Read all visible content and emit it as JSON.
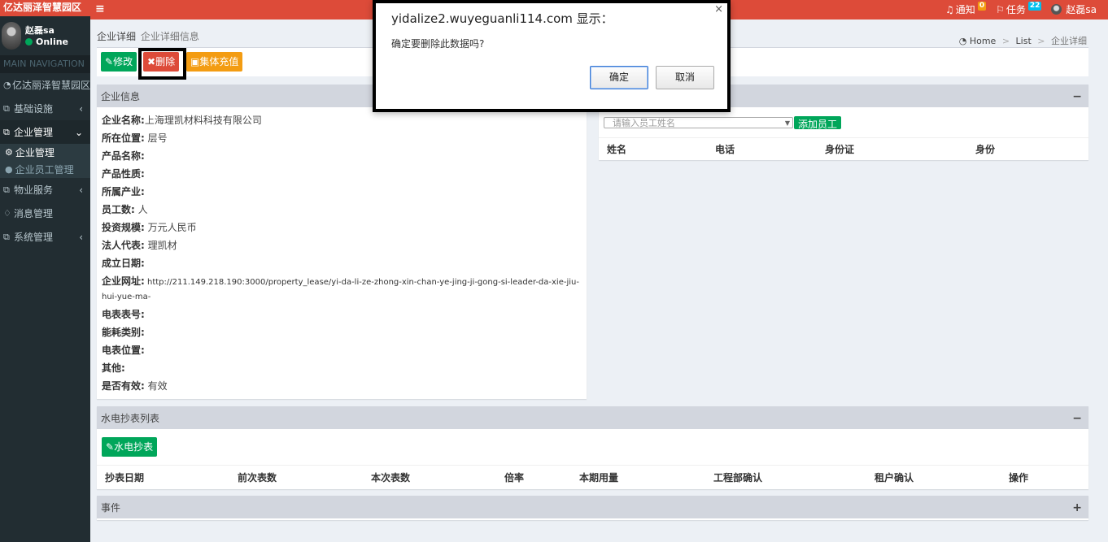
{
  "sidebar": {
    "logo": "亿达丽泽智慧园区",
    "user_name": "赵磊sa",
    "status": "Online",
    "nav_header": "MAIN NAVIGATION",
    "items": [
      {
        "label": "亿达丽泽智慧园区",
        "icon": "dashboard-icon"
      },
      {
        "label": "基础设施",
        "icon": "copy-icon"
      },
      {
        "label": "企业管理",
        "icon": "copy-icon"
      },
      {
        "label": "物业服务",
        "icon": "copy-icon"
      },
      {
        "label": "消息管理",
        "icon": "bell-icon"
      },
      {
        "label": "系统管理",
        "icon": "copy-icon"
      }
    ],
    "sub_items": [
      {
        "label": "企业管理",
        "icon": "gear-icon"
      },
      {
        "label": "企业员工管理",
        "icon": "user-icon"
      }
    ]
  },
  "topbar": {
    "notices_label": "通知",
    "notices_count": "0",
    "tasks_label": "任务",
    "tasks_count": "22",
    "user_name": "赵磊sa"
  },
  "page": {
    "title": "企业详细",
    "subtitle": "企业详细信息",
    "breadcrumb": [
      "Home",
      "List",
      "企业详细"
    ]
  },
  "actions": {
    "edit": "修改",
    "delete": "删除",
    "recharge": "集体充值"
  },
  "company": {
    "header": "企业信息",
    "collapse": "−",
    "rows": [
      {
        "label": "企业名称:",
        "value": "上海理凯材料科技有限公司"
      },
      {
        "label": "所在位置:",
        "value": " 层号"
      },
      {
        "label": "产品名称:",
        "value": ""
      },
      {
        "label": "产品性质:",
        "value": ""
      },
      {
        "label": "所属产业:",
        "value": ""
      },
      {
        "label": "员工数:",
        "value": " 人"
      },
      {
        "label": "投资规模:",
        "value": " 万元人民币"
      },
      {
        "label": "法人代表:",
        "value": " 理凯材"
      },
      {
        "label": "成立日期:",
        "value": ""
      },
      {
        "label": "企业网址:",
        "value": " http://211.149.218.190:3000/property_lease/yi-da-li-ze-zhong-xin-chan-ye-jing-ji-gong-si-leader-da-xie-jiu-hui-yue-ma-"
      },
      {
        "label": "电表表号:",
        "value": ""
      },
      {
        "label": "能耗类别:",
        "value": ""
      },
      {
        "label": "电表位置:",
        "value": ""
      },
      {
        "label": "其他:",
        "value": ""
      },
      {
        "label": "是否有效:",
        "value": " 有效"
      }
    ]
  },
  "staff": {
    "collapse": "−",
    "select_placeholder": "请输入员工姓名",
    "add_button": "添加员工",
    "columns": [
      "姓名",
      "电话",
      "身份证",
      "身份"
    ]
  },
  "meter": {
    "header": "水电抄表列表",
    "collapse": "−",
    "button": "水电抄表",
    "columns": [
      "抄表日期",
      "前次表数",
      "本次表数",
      "倍率",
      "本期用量",
      "工程部确认",
      "租户确认",
      "操作"
    ]
  },
  "event": {
    "header": "事件",
    "expand": "+"
  },
  "dialog": {
    "title": "yidalize2.wuyeguanli114.com 显示：",
    "message": "确定要删除此数据吗?",
    "ok": "确定",
    "cancel": "取消",
    "close": "×"
  }
}
